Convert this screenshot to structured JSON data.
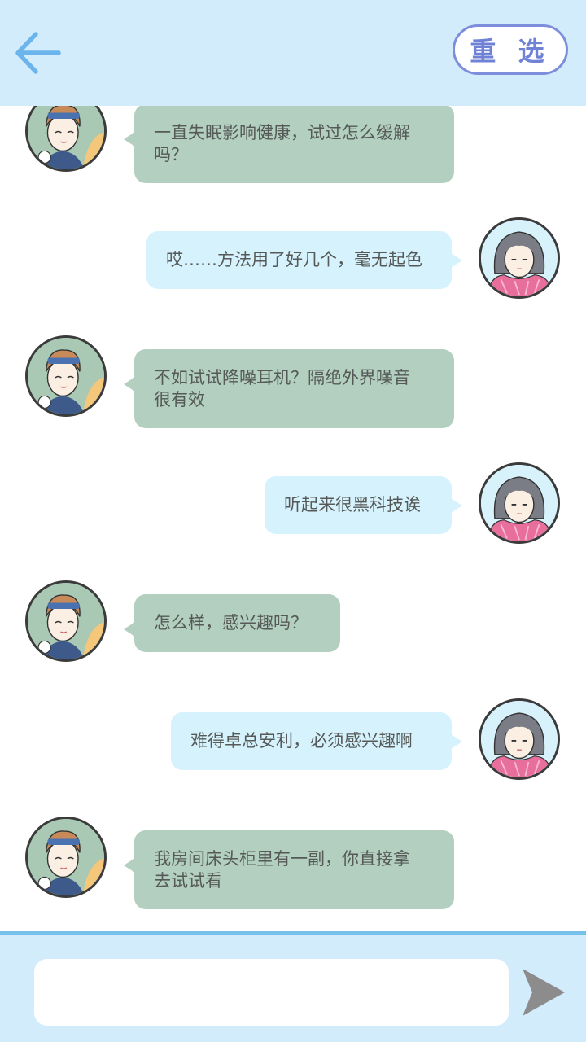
{
  "header": {
    "back_icon": "arrow-left-icon",
    "reselect_label": "重 选",
    "accent_color": "#7d8fdc",
    "background_color": "#d3ecfc"
  },
  "messages": [
    {
      "sender": "boy",
      "text_line1": "一直失眠影响健康，试过怎么缓解",
      "text_line2": "吗？"
    },
    {
      "sender": "girl",
      "text_line1": "哎……方法用了好几个，毫无起色",
      "text_line2": ""
    },
    {
      "sender": "boy",
      "text_line1": "不如试试降噪耳机？隔绝外界噪音",
      "text_line2": "很有效"
    },
    {
      "sender": "girl",
      "text_line1": "听起来很黑科技诶",
      "text_line2": ""
    },
    {
      "sender": "boy",
      "text_line1": "怎么样，感兴趣吗？",
      "text_line2": ""
    },
    {
      "sender": "girl",
      "text_line1": "难得卓总安利，必须感兴趣啊",
      "text_line2": ""
    },
    {
      "sender": "boy",
      "text_line1": "我房间床头柜里有一副，你直接拿",
      "text_line2": "去试试看"
    }
  ],
  "footer": {
    "input_value": "",
    "send_icon": "send-arrow-icon",
    "border_color": "#78c0ec"
  }
}
